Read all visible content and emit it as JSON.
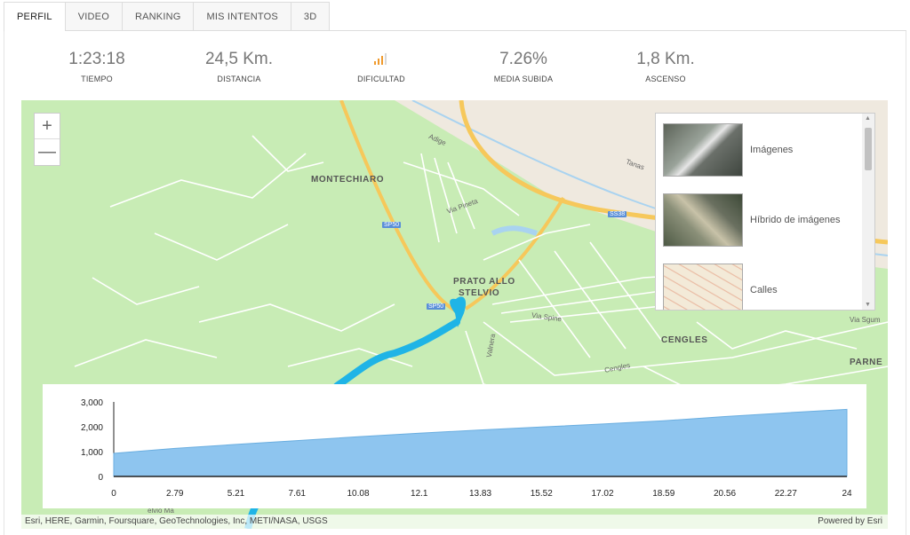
{
  "tabs": [
    {
      "label": "PERFIL",
      "active": true
    },
    {
      "label": "VIDEO"
    },
    {
      "label": "RANKING"
    },
    {
      "label": "MIS INTENTOS"
    },
    {
      "label": "3D"
    }
  ],
  "stats": {
    "tiempo": {
      "value": "1:23:18",
      "label": "TIEMPO"
    },
    "distancia": {
      "value": "24,5 Km.",
      "label": "DISTANCIA"
    },
    "dificultad": {
      "icon": "signal-bars-icon",
      "label": "DIFICULTAD"
    },
    "media": {
      "value": "7.26%",
      "label": "MEDIA SUBIDA"
    },
    "ascenso": {
      "value": "1,8 Km.",
      "label": "ASCENSO"
    }
  },
  "map": {
    "zoom_in": "+",
    "zoom_out": "—",
    "labels": {
      "montechiaro": "MONTECHIARO",
      "prato1": "PRATO ALLO",
      "prato2": "STELVIO",
      "cengles": "CENGLES",
      "parne": "PARNE",
      "adige": "Adige",
      "tanas": "Tanas",
      "via_pineta": "Via Pineta",
      "via_spine": "Via Spine",
      "valnera": "Valnera",
      "cengles_road": "Cengles",
      "via_sgum": "Via Sgum",
      "stelvio": "elvio Ma",
      "sp50": "SP50",
      "sp50b": "SP50",
      "ss38": "SS38"
    },
    "basemaps": [
      {
        "label": "Imágenes"
      },
      {
        "label": "Híbrido de imágenes"
      },
      {
        "label": "Calles"
      }
    ],
    "attribution": "Esri, HERE, Garmin, Foursquare, GeoTechnologies, Inc, METI/NASA, USGS",
    "powered": "Powered by Esri"
  },
  "chart_data": {
    "type": "area",
    "x": [
      "0",
      "2.79",
      "5.21",
      "7.61",
      "10.08",
      "12.1",
      "13.83",
      "15.52",
      "17.02",
      "18.59",
      "20.56",
      "22.27",
      "24"
    ],
    "y_ticks": [
      "3,000",
      "2,000",
      "1,000",
      "0"
    ],
    "ylim": [
      0,
      3000
    ],
    "values": [
      930,
      1130,
      1290,
      1440,
      1600,
      1740,
      1870,
      1990,
      2110,
      2240,
      2410,
      2560,
      2700
    ],
    "fill": "#8ec5ef",
    "stroke": "#6aaee0"
  }
}
